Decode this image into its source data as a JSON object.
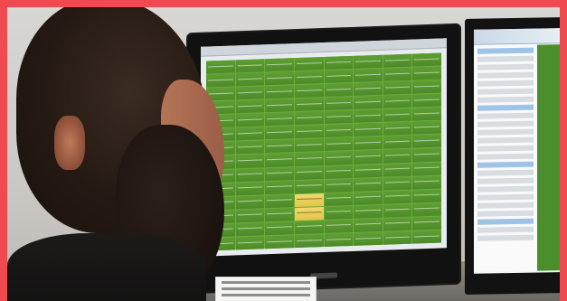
{
  "scene": {
    "description_tag": "photo",
    "border_color": "#ef4a4f",
    "accent_green": "#6cab3b",
    "highlight_yellow": "#e2c54a"
  },
  "main_monitor": {
    "grid": {
      "rows": 14,
      "cols": 8,
      "highlight_cell": {
        "row": 10,
        "col": 3
      }
    }
  },
  "side_monitor": {
    "panel_rows": 24
  }
}
